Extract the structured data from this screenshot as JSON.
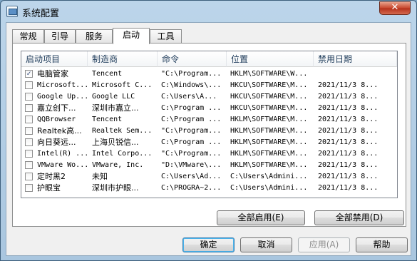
{
  "window": {
    "title": "系统配置",
    "close": "✕"
  },
  "tabs": [
    "常规",
    "引导",
    "服务",
    "启动",
    "工具"
  ],
  "active_tab": "启动",
  "columns": [
    "启动项目",
    "制造商",
    "命令",
    "位置",
    "禁用日期"
  ],
  "rows": [
    {
      "checked": true,
      "item": "电脑管家",
      "maker": "Tencent",
      "command": "\"C:\\Program...",
      "location": "HKLM\\SOFTWARE\\W...",
      "date": ""
    },
    {
      "checked": false,
      "item": "Microsoft...",
      "maker": "Microsoft C...",
      "command": "C:\\Windows\\...",
      "location": "HKCU\\SOFTWARE\\M...",
      "date": "2021/11/3 8..."
    },
    {
      "checked": false,
      "item": "Google Up...",
      "maker": "Google LLC",
      "command": "C:\\Users\\A...",
      "location": "HKCU\\SOFTWARE\\M...",
      "date": "2021/11/3 8..."
    },
    {
      "checked": false,
      "item": "嘉立创下...",
      "maker": "深圳市嘉立...",
      "command": "C:\\Program ...",
      "location": "HKCU\\SOFTWARE\\M...",
      "date": "2021/11/3 8..."
    },
    {
      "checked": false,
      "item": "QQBrowser",
      "maker": "Tencent",
      "command": "C:\\Program ...",
      "location": "HKLM\\SOFTWARE\\M...",
      "date": "2021/11/3 8..."
    },
    {
      "checked": false,
      "item": "Realtek高...",
      "maker": "Realtek Sem...",
      "command": "\"C:\\Program...",
      "location": "HKLM\\SOFTWARE\\M...",
      "date": "2021/11/3 8..."
    },
    {
      "checked": false,
      "item": "向日葵远...",
      "maker": "上海贝锐信...",
      "command": "C:\\Program ...",
      "location": "HKLM\\SOFTWARE\\M...",
      "date": "2021/11/3 8..."
    },
    {
      "checked": false,
      "item": "Intel(R) ...",
      "maker": "Intel Corpo...",
      "command": "\"C:\\Program...",
      "location": "HKLM\\SOFTWARE\\M...",
      "date": "2021/11/3 8..."
    },
    {
      "checked": false,
      "item": "VMware Wo...",
      "maker": "VMware, Inc.",
      "command": "\"D:\\VMware\\...",
      "location": "HKLM\\SOFTWARE\\M...",
      "date": "2021/11/3 8..."
    },
    {
      "checked": false,
      "item": "定时黑2",
      "maker": "未知",
      "command": "C:\\Users\\Ad...",
      "location": "C:\\Users\\Admini...",
      "date": "2021/11/3 8..."
    },
    {
      "checked": false,
      "item": "护眼宝",
      "maker": "深圳市护眼...",
      "command": "C:\\PROGRA~2...",
      "location": "C:\\Users\\Admini...",
      "date": "2021/11/3 8..."
    }
  ],
  "panel_buttons": {
    "enable_all": "全部启用(E)",
    "disable_all": "全部禁用(D)"
  },
  "dialog_buttons": {
    "ok": "确定",
    "cancel": "取消",
    "apply": "应用(A)",
    "help": "帮助"
  }
}
